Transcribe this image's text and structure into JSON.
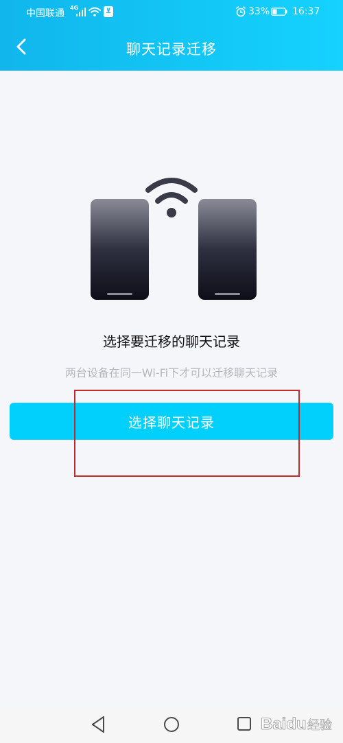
{
  "status_bar": {
    "carrier": "中国联通",
    "network": "4G",
    "battery": "33%",
    "time": "16:37"
  },
  "header": {
    "title": "聊天记录迁移"
  },
  "main": {
    "title": "选择要迁移的聊天记录",
    "hint": "两台设备在同一Wi-Fi下才可以迁移聊天记录",
    "button_label": "选择聊天记录"
  },
  "watermark": {
    "brand": "Baidu",
    "suffix": "经验"
  },
  "icons": {
    "back": "chevron-left-icon",
    "wifi": "wifi-icon",
    "phone": "phone-icon",
    "alarm": "alarm-icon",
    "battery": "battery-icon"
  },
  "colors": {
    "header_start": "#11b6ec",
    "header_end": "#15d2ff",
    "button": "#00d0fb",
    "highlight": "#c3292e",
    "hint": "#b6b6bd"
  }
}
